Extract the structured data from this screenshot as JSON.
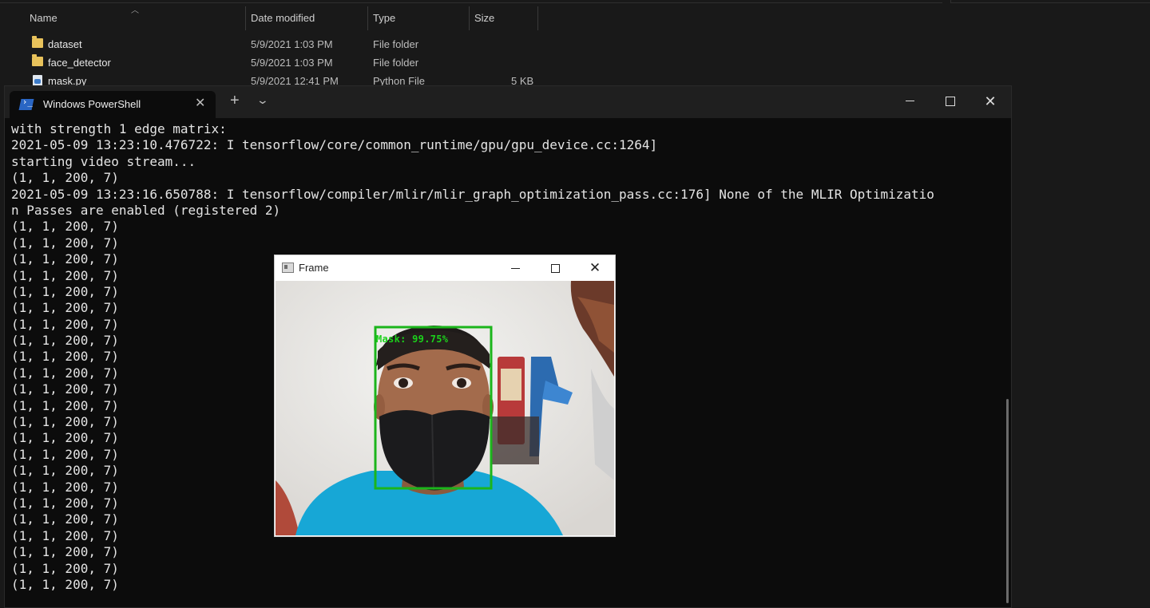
{
  "explorer": {
    "columns": {
      "name": "Name",
      "date": "Date modified",
      "type": "Type",
      "size": "Size"
    },
    "files": [
      {
        "name": "dataset",
        "date": "5/9/2021 1:03 PM",
        "type": "File folder",
        "size": "",
        "icon": "folder-icon"
      },
      {
        "name": "face_detector",
        "date": "5/9/2021 1:03 PM",
        "type": "File folder",
        "size": "",
        "icon": "folder-icon"
      },
      {
        "name": "mask.py",
        "date": "5/9/2021 12:41 PM",
        "type": "Python File",
        "size": "5 KB",
        "icon": "python-file-icon"
      }
    ]
  },
  "powershell": {
    "tab_title": "Windows PowerShell",
    "icon": "powershell-icon",
    "lines": [
      "with strength 1 edge matrix:",
      "2021-05-09 13:23:10.476722: I tensorflow/core/common_runtime/gpu/gpu_device.cc:1264]",
      "starting video stream...",
      "(1, 1, 200, 7)",
      "2021-05-09 13:23:16.650788: I tensorflow/compiler/mlir/mlir_graph_optimization_pass.cc:176] None of the MLIR Optimizatio",
      "n Passes are enabled (registered 2)",
      "(1, 1, 200, 7)",
      "(1, 1, 200, 7)",
      "(1, 1, 200, 7)",
      "(1, 1, 200, 7)",
      "(1, 1, 200, 7)",
      "(1, 1, 200, 7)",
      "(1, 1, 200, 7)",
      "(1, 1, 200, 7)",
      "(1, 1, 200, 7)",
      "(1, 1, 200, 7)",
      "(1, 1, 200, 7)",
      "(1, 1, 200, 7)",
      "(1, 1, 200, 7)",
      "(1, 1, 200, 7)",
      "(1, 1, 200, 7)",
      "(1, 1, 200, 7)",
      "(1, 1, 200, 7)",
      "(1, 1, 200, 7)",
      "(1, 1, 200, 7)",
      "(1, 1, 200, 7)",
      "(1, 1, 200, 7)",
      "(1, 1, 200, 7)",
      "(1, 1, 200, 7)"
    ]
  },
  "frame": {
    "title": "Frame",
    "detection_label": "Mask: 99.75%",
    "box_color": "#1bb51b"
  }
}
